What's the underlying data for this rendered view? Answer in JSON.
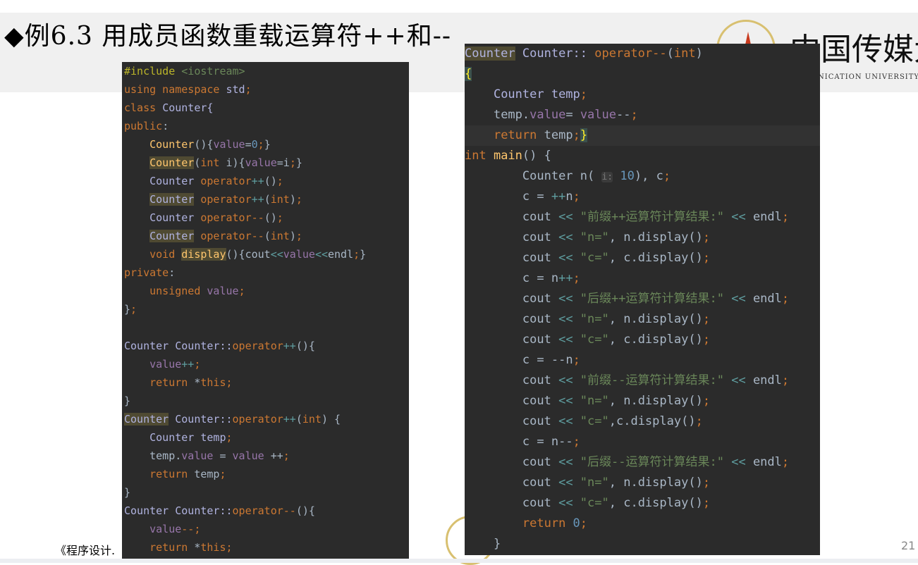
{
  "slide": {
    "title": "◆例6.3 用成员函数重载运算符++和--",
    "page_number": "21",
    "footer_text": "《程序设计.",
    "logo_text": "中国传媒大",
    "logo_subtext": "NICATION UNIVERSITY"
  },
  "colors": {
    "code_bg": "#2b2b2b",
    "keyword": "#cc7832",
    "class": "#b0b3e0",
    "function": "#ffc66d",
    "field": "#9876aa",
    "string": "#6a8759",
    "number": "#6897bb"
  },
  "left_code": [
    [
      [
        "#include ",
        "pp"
      ],
      [
        "<iostream>",
        "str"
      ]
    ],
    [
      [
        "using namespace ",
        "kw"
      ],
      [
        "std",
        "cls"
      ],
      [
        ";",
        "kw"
      ]
    ],
    [
      [
        "class ",
        "kw"
      ],
      [
        "Counter{",
        "cls"
      ]
    ],
    [
      [
        "public",
        "kw"
      ],
      [
        ":",
        "pl"
      ]
    ],
    [
      [
        "    ",
        "pl"
      ],
      [
        "Counter",
        "fn"
      ],
      [
        "(){",
        "pl"
      ],
      [
        "value",
        "field"
      ],
      [
        "=",
        "pl"
      ],
      [
        "0",
        "num"
      ],
      [
        ";",
        "kw"
      ],
      [
        "}",
        "pl"
      ]
    ],
    [
      [
        "    ",
        "pl"
      ],
      [
        "Counter",
        "fn",
        "hl"
      ],
      [
        "(",
        "pl"
      ],
      [
        "int ",
        "kw"
      ],
      [
        "i){",
        "pl"
      ],
      [
        "value",
        "field"
      ],
      [
        "=i",
        "pl"
      ],
      [
        ";",
        "kw"
      ],
      [
        "}",
        "pl"
      ]
    ],
    [
      [
        "    ",
        "pl"
      ],
      [
        "Counter ",
        "cls"
      ],
      [
        "operator",
        "kw"
      ],
      [
        "++",
        "op"
      ],
      [
        "()",
        "pl"
      ],
      [
        ";",
        "kw"
      ]
    ],
    [
      [
        "    ",
        "pl"
      ],
      [
        "Counter",
        "cls",
        "hl"
      ],
      [
        " operator",
        "kw"
      ],
      [
        "++",
        "op"
      ],
      [
        "(",
        "pl"
      ],
      [
        "int",
        "kw"
      ],
      [
        ")",
        "pl"
      ],
      [
        ";",
        "kw"
      ]
    ],
    [
      [
        "    ",
        "pl"
      ],
      [
        "Counter ",
        "cls"
      ],
      [
        "operator",
        "kw"
      ],
      [
        "--",
        "kw"
      ],
      [
        "()",
        "pl"
      ],
      [
        ";",
        "kw"
      ]
    ],
    [
      [
        "    ",
        "pl"
      ],
      [
        "Counter",
        "cls",
        "hl"
      ],
      [
        " operator",
        "kw"
      ],
      [
        "--",
        "kw"
      ],
      [
        "(",
        "pl"
      ],
      [
        "int",
        "kw"
      ],
      [
        ")",
        "pl"
      ],
      [
        ";",
        "kw"
      ]
    ],
    [
      [
        "    ",
        "pl"
      ],
      [
        "void ",
        "kw"
      ],
      [
        "display",
        "fn",
        "hl"
      ],
      [
        "(){cout",
        "pl"
      ],
      [
        "<<",
        "op"
      ],
      [
        "value",
        "field"
      ],
      [
        "<<",
        "op"
      ],
      [
        "endl",
        "pl"
      ],
      [
        ";",
        "kw"
      ],
      [
        "}",
        "pl"
      ]
    ],
    [
      [
        "private",
        "kw"
      ],
      [
        ":",
        "pl"
      ]
    ],
    [
      [
        "    ",
        "pl"
      ],
      [
        "unsigned ",
        "kw"
      ],
      [
        "value",
        "field"
      ],
      [
        ";",
        "kw"
      ]
    ],
    [
      [
        "}",
        "pl"
      ],
      [
        ";",
        "kw"
      ]
    ],
    [],
    [
      [
        "Counter Counter::",
        "cls"
      ],
      [
        "operator",
        "kw"
      ],
      [
        "++",
        "op"
      ],
      [
        "(){",
        "pl"
      ]
    ],
    [
      [
        "    ",
        "pl"
      ],
      [
        "value",
        "field"
      ],
      [
        "++",
        "op"
      ],
      [
        ";",
        "kw"
      ]
    ],
    [
      [
        "    ",
        "pl"
      ],
      [
        "return ",
        "kw"
      ],
      [
        "*",
        "pl"
      ],
      [
        "this",
        "kw"
      ],
      [
        ";",
        "kw"
      ]
    ],
    [
      [
        "}",
        "pl"
      ]
    ],
    [
      [
        "Counter",
        "cls",
        "hl"
      ],
      [
        " Counter::",
        "cls"
      ],
      [
        "operator",
        "kw"
      ],
      [
        "++",
        "op"
      ],
      [
        "(",
        "pl"
      ],
      [
        "int",
        "kw"
      ],
      [
        ") {",
        "pl"
      ]
    ],
    [
      [
        "    ",
        "pl"
      ],
      [
        "Counter temp",
        "cls"
      ],
      [
        ";",
        "kw"
      ]
    ],
    [
      [
        "    ",
        "pl"
      ],
      [
        "temp.",
        "pl"
      ],
      [
        "value",
        "field"
      ],
      [
        " = ",
        "pl"
      ],
      [
        "value",
        "field"
      ],
      [
        " ++",
        "pl"
      ],
      [
        ";",
        "kw"
      ]
    ],
    [
      [
        "    ",
        "pl"
      ],
      [
        "return ",
        "kw"
      ],
      [
        "temp",
        "pl"
      ],
      [
        ";",
        "kw"
      ]
    ],
    [
      [
        "}",
        "pl"
      ]
    ],
    [
      [
        "Counter Counter::",
        "cls"
      ],
      [
        "operator",
        "kw"
      ],
      [
        "--",
        "kw"
      ],
      [
        "(){",
        "pl"
      ]
    ],
    [
      [
        "    ",
        "pl"
      ],
      [
        "value",
        "field"
      ],
      [
        "--",
        "kw"
      ],
      [
        ";",
        "kw"
      ]
    ],
    [
      [
        "    ",
        "pl"
      ],
      [
        "return ",
        "kw"
      ],
      [
        "*",
        "pl"
      ],
      [
        "this",
        "kw"
      ],
      [
        ";",
        "kw"
      ]
    ]
  ],
  "right_code": [
    [
      [
        "Counter",
        "cls",
        "hl"
      ],
      [
        " Counter:: ",
        "cls"
      ],
      [
        "operator",
        "kw"
      ],
      [
        "--",
        "kw"
      ],
      [
        "(",
        "pl"
      ],
      [
        "int",
        "kw"
      ],
      [
        ")",
        "pl"
      ]
    ],
    [
      [
        "{",
        "brace"
      ]
    ],
    [
      [
        "    ",
        "pl"
      ],
      [
        "Counter temp",
        "cls"
      ],
      [
        ";",
        "kw"
      ]
    ],
    [
      [
        "    ",
        "pl"
      ],
      [
        "temp.",
        "pl"
      ],
      [
        "value",
        "field"
      ],
      [
        "= ",
        "pl"
      ],
      [
        "value",
        "field"
      ],
      [
        "--",
        "pl"
      ],
      [
        ";",
        "kw"
      ]
    ],
    [
      [
        "    ",
        "pl"
      ],
      [
        "return ",
        "kw"
      ],
      [
        "temp",
        "pl"
      ],
      [
        ";",
        "kw"
      ],
      [
        "}",
        "brace"
      ]
    ],
    [
      [
        "int ",
        "kw"
      ],
      [
        "main",
        "fn"
      ],
      [
        "() {",
        "pl"
      ]
    ],
    [
      [
        "        ",
        "pl"
      ],
      [
        "Counter n( ",
        "pl"
      ],
      [
        "i:",
        "hint"
      ],
      [
        " 10",
        "num"
      ],
      [
        "), c",
        ",pl"
      ],
      [
        ";",
        "kw"
      ]
    ],
    [
      [
        "        ",
        "pl"
      ],
      [
        "c = ",
        "pl"
      ],
      [
        "++",
        "op"
      ],
      [
        "n",
        ",pl"
      ],
      [
        ";",
        "kw"
      ]
    ],
    [
      [
        "        ",
        "pl"
      ],
      [
        "cout ",
        "pl"
      ],
      [
        "<< ",
        "op"
      ],
      [
        "\"前缀++运算符计算结果:\"",
        "str"
      ],
      [
        " << ",
        "op"
      ],
      [
        "endl",
        "pl"
      ],
      [
        ";",
        "kw"
      ]
    ],
    [
      [
        "        ",
        "pl"
      ],
      [
        "cout ",
        "pl"
      ],
      [
        "<< ",
        "op"
      ],
      [
        "\"n=\"",
        "str"
      ],
      [
        ", n.display()",
        "pl"
      ],
      [
        ";",
        "kw"
      ]
    ],
    [
      [
        "        ",
        "pl"
      ],
      [
        "cout ",
        "pl"
      ],
      [
        "<< ",
        "op"
      ],
      [
        "\"c=\"",
        "str"
      ],
      [
        ", c.display()",
        "pl"
      ],
      [
        ";",
        "kw"
      ]
    ],
    [
      [
        "        ",
        "pl"
      ],
      [
        "c = n",
        "pl"
      ],
      [
        "++",
        "op"
      ],
      [
        ";",
        "kw"
      ]
    ],
    [
      [
        "        ",
        "pl"
      ],
      [
        "cout ",
        "pl"
      ],
      [
        "<< ",
        "op"
      ],
      [
        "\"后缀++运算符计算结果:\"",
        "str"
      ],
      [
        " << ",
        "op"
      ],
      [
        "endl",
        "pl"
      ],
      [
        ";",
        "kw"
      ]
    ],
    [
      [
        "        ",
        "pl"
      ],
      [
        "cout ",
        "pl"
      ],
      [
        "<< ",
        "op"
      ],
      [
        "\"n=\"",
        "str"
      ],
      [
        ", n.display()",
        "pl"
      ],
      [
        ";",
        "kw"
      ]
    ],
    [
      [
        "        ",
        "pl"
      ],
      [
        "cout ",
        "pl"
      ],
      [
        "<< ",
        "op"
      ],
      [
        "\"c=\"",
        "str"
      ],
      [
        ", c.display()",
        "pl"
      ],
      [
        ";",
        "kw"
      ]
    ],
    [
      [
        "        ",
        "pl"
      ],
      [
        "c = ",
        "pl"
      ],
      [
        "--",
        "pl"
      ],
      [
        "n",
        "pl"
      ],
      [
        ";",
        "kw"
      ]
    ],
    [
      [
        "        ",
        "pl"
      ],
      [
        "cout ",
        "pl"
      ],
      [
        "<< ",
        "op"
      ],
      [
        "\"前缀--运算符计算结果:\"",
        "str"
      ],
      [
        " << ",
        "op"
      ],
      [
        "endl",
        "pl"
      ],
      [
        ";",
        "kw"
      ]
    ],
    [
      [
        "        ",
        "pl"
      ],
      [
        "cout ",
        "pl"
      ],
      [
        "<< ",
        "op"
      ],
      [
        "\"n=\"",
        "str"
      ],
      [
        ", n.display()",
        "pl"
      ],
      [
        ";",
        "kw"
      ]
    ],
    [
      [
        "        ",
        "pl"
      ],
      [
        "cout ",
        "pl"
      ],
      [
        "<< ",
        "op"
      ],
      [
        "\"c=\"",
        "str"
      ],
      [
        ",c.display()",
        "pl"
      ],
      [
        ";",
        "kw"
      ]
    ],
    [
      [
        "        ",
        "pl"
      ],
      [
        "c = n",
        "pl"
      ],
      [
        "--",
        "pl"
      ],
      [
        ";",
        "kw"
      ]
    ],
    [
      [
        "        ",
        "pl"
      ],
      [
        "cout ",
        "pl"
      ],
      [
        "<< ",
        "op"
      ],
      [
        "\"后缀--运算符计算结果:\"",
        "str"
      ],
      [
        " << ",
        "op"
      ],
      [
        "endl",
        "pl"
      ],
      [
        ";",
        "kw"
      ]
    ],
    [
      [
        "        ",
        "pl"
      ],
      [
        "cout ",
        "pl"
      ],
      [
        "<< ",
        "op"
      ],
      [
        "\"n=\"",
        "str"
      ],
      [
        ", n.display()",
        "pl"
      ],
      [
        ";",
        "kw"
      ]
    ],
    [
      [
        "        ",
        "pl"
      ],
      [
        "cout ",
        "pl"
      ],
      [
        "<< ",
        "op"
      ],
      [
        "\"c=\"",
        "str"
      ],
      [
        ", c.display()",
        "pl"
      ],
      [
        ";",
        "kw"
      ]
    ],
    [
      [
        "        ",
        "pl"
      ],
      [
        "return ",
        "kw"
      ],
      [
        "0",
        "num"
      ],
      [
        ";",
        "kw"
      ]
    ],
    [
      [
        "    }",
        "pl"
      ]
    ]
  ]
}
